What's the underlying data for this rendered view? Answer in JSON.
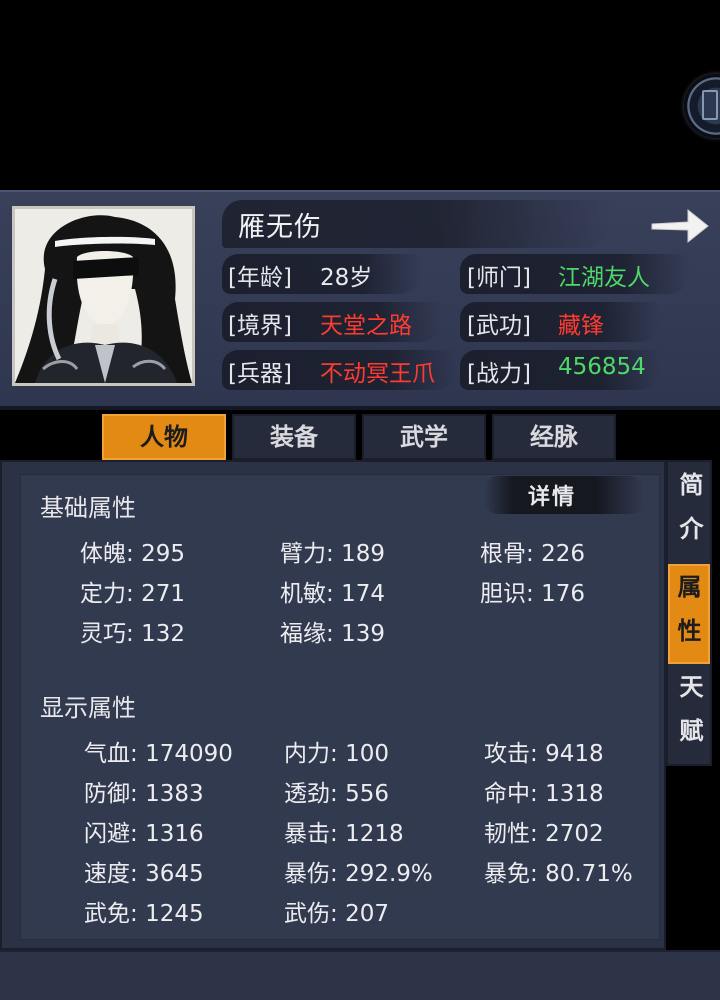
{
  "character": {
    "name": "雁无伤",
    "age_label": "[年龄]",
    "age_value": "28岁",
    "sect_label": "[师门]",
    "sect_value": "江湖友人",
    "realm_label": "[境界]",
    "realm_value": "天堂之路",
    "skill_label": "[武功]",
    "skill_value": "藏锋",
    "weapon_label": "[兵器]",
    "weapon_value": "不动冥王爪",
    "power_label": "[战力]",
    "power_value": "456854"
  },
  "tabs": [
    "人物",
    "装备",
    "武学",
    "经脉"
  ],
  "active_tab": "人物",
  "side_tabs": [
    "简介",
    "属性",
    "天赋"
  ],
  "active_side_tab": "属性",
  "detail_button": "详情",
  "basic_attributes": {
    "title": "基础属性",
    "items": [
      {
        "label": "体魄",
        "value": "295"
      },
      {
        "label": "臂力",
        "value": "189"
      },
      {
        "label": "根骨",
        "value": "226"
      },
      {
        "label": "定力",
        "value": "271"
      },
      {
        "label": "机敏",
        "value": "174"
      },
      {
        "label": "胆识",
        "value": "176"
      },
      {
        "label": "灵巧",
        "value": "132"
      },
      {
        "label": "福缘",
        "value": "139"
      }
    ]
  },
  "display_attributes": {
    "title": "显示属性",
    "items": [
      {
        "label": "气血",
        "value": "174090"
      },
      {
        "label": "内力",
        "value": "100"
      },
      {
        "label": "攻击",
        "value": "9418"
      },
      {
        "label": "防御",
        "value": "1383"
      },
      {
        "label": "透劲",
        "value": "556"
      },
      {
        "label": "命中",
        "value": "1318"
      },
      {
        "label": "闪避",
        "value": "1316"
      },
      {
        "label": "暴击",
        "value": "1218"
      },
      {
        "label": "韧性",
        "value": "2702"
      },
      {
        "label": "速度",
        "value": "3645"
      },
      {
        "label": "暴伤",
        "value": "292.9%"
      },
      {
        "label": "暴免",
        "value": "80.71%"
      },
      {
        "label": "武免",
        "value": "1245"
      },
      {
        "label": "武伤",
        "value": "207"
      }
    ]
  },
  "colors": {
    "accent_orange": "#e38a14",
    "value_green": "#4fd86a",
    "value_red": "#ff3b30",
    "panel_bg": "#323a50"
  }
}
